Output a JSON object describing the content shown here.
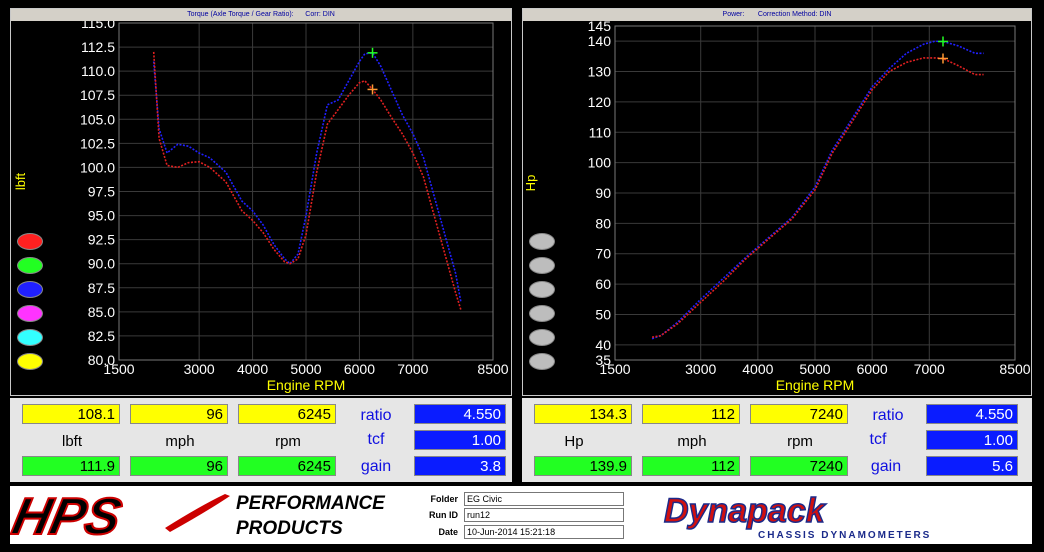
{
  "chart_data": [
    {
      "type": "line",
      "title": "Torque (Axle Torque / Gear Ratio):      Corr: DIN",
      "xlabel": "Engine RPM",
      "ylabel": "lbft",
      "xlim": [
        1500,
        8500
      ],
      "ylim": [
        80.0,
        115.0
      ],
      "xticks": [
        "1500",
        "3000",
        "4000",
        "5000",
        "6000",
        "7000",
        "8500"
      ],
      "yticks": [
        "80.0",
        "82.5",
        "85.0",
        "87.5",
        "90.0",
        "92.5",
        "95.0",
        "97.5",
        "100.0",
        "102.5",
        "105.0",
        "107.5",
        "110.0",
        "112.5",
        "115.0"
      ],
      "series": [
        {
          "color": "#2020ff",
          "x": [
            2150,
            2250,
            2400,
            2600,
            2800,
            3000,
            3200,
            3500,
            3800,
            4000,
            4200,
            4400,
            4600,
            4700,
            4850,
            5000,
            5200,
            5400,
            5600,
            5800,
            6000,
            6100,
            6245,
            6400,
            6600,
            6800,
            7000,
            7200,
            7400,
            7600,
            7800,
            7900
          ],
          "y": [
            111,
            104,
            101.5,
            102.4,
            102.2,
            101.5,
            101.0,
            99.5,
            96.5,
            95.5,
            94.0,
            92.0,
            90.5,
            90.0,
            91.0,
            95.0,
            101.5,
            106.5,
            107.0,
            109.0,
            111.0,
            111.8,
            111.9,
            110.5,
            108.0,
            105.5,
            103.5,
            101.0,
            97.0,
            93.0,
            89.0,
            86.0
          ]
        },
        {
          "color": "#e02020",
          "x": [
            2150,
            2250,
            2400,
            2600,
            2800,
            3000,
            3200,
            3500,
            3800,
            4000,
            4200,
            4400,
            4600,
            4700,
            4850,
            5000,
            5200,
            5400,
            5600,
            5800,
            6000,
            6100,
            6245,
            6400,
            6600,
            6800,
            7000,
            7200,
            7400,
            7600,
            7800,
            7900
          ],
          "y": [
            112,
            103,
            100.2,
            100.0,
            100.5,
            100.6,
            100.0,
            98.5,
            95.5,
            94.5,
            93.2,
            91.5,
            90.2,
            90.0,
            90.5,
            93.0,
            99.5,
            104.5,
            106.0,
            107.5,
            108.8,
            109.0,
            108.1,
            107.0,
            105.2,
            103.5,
            101.5,
            99.0,
            95.0,
            91.0,
            87.0,
            85.2
          ]
        }
      ],
      "markers": [
        {
          "x": 6245,
          "y": 111.9,
          "color": "#22ff22"
        },
        {
          "x": 6245,
          "y": 108.1,
          "color": "#ff9933"
        }
      ]
    },
    {
      "type": "line",
      "title": "Power:       Correction Method: DIN",
      "xlabel": "Engine RPM",
      "ylabel": "Hp",
      "xlim": [
        1500,
        8500
      ],
      "ylim": [
        35,
        145
      ],
      "xticks": [
        "1500",
        "3000",
        "4000",
        "5000",
        "6000",
        "7000",
        "8500"
      ],
      "yticks": [
        "35",
        "40",
        "50",
        "60",
        "70",
        "80",
        "90",
        "100",
        "110",
        "120",
        "130",
        "140",
        "145"
      ],
      "series": [
        {
          "color": "#2020ff",
          "x": [
            2150,
            2300,
            2600,
            3000,
            3400,
            3800,
            4200,
            4600,
            5000,
            5300,
            5600,
            6000,
            6300,
            6600,
            6900,
            7100,
            7240,
            7500,
            7800,
            7950
          ],
          "y": [
            42,
            43,
            47.5,
            55,
            62,
            69,
            75.5,
            82,
            92,
            104,
            113,
            125,
            131,
            136,
            139,
            140,
            139.9,
            138.5,
            136,
            136
          ]
        },
        {
          "color": "#e02020",
          "x": [
            2150,
            2300,
            2600,
            3000,
            3400,
            3800,
            4200,
            4600,
            5000,
            5300,
            5600,
            6000,
            6300,
            6600,
            6900,
            7100,
            7240,
            7500,
            7800,
            7950
          ],
          "y": [
            42.5,
            43,
            47,
            54,
            61,
            68.5,
            75,
            81.5,
            91,
            103,
            112,
            124,
            130,
            133,
            134.5,
            134.5,
            134.3,
            132,
            129,
            129
          ]
        }
      ],
      "markers": [
        {
          "x": 7240,
          "y": 139.9,
          "color": "#22ff22"
        },
        {
          "x": 7240,
          "y": 134.3,
          "color": "#ff9933"
        }
      ]
    }
  ],
  "torque_readout": {
    "top": [
      "108.1",
      "96",
      "6245"
    ],
    "units": [
      "lbft",
      "mph",
      "rpm"
    ],
    "bottom": [
      "111.9",
      "96",
      "6245"
    ],
    "ratio_label": "ratio",
    "ratio": "4.550",
    "tcf_label": "tcf",
    "tcf": "1.00",
    "gain_label": "gain",
    "gain": "3.8"
  },
  "power_readout": {
    "top": [
      "134.3",
      "112",
      "7240"
    ],
    "units": [
      "Hp",
      "mph",
      "rpm"
    ],
    "bottom": [
      "139.9",
      "112",
      "7240"
    ],
    "ratio_label": "ratio",
    "ratio": "4.550",
    "tcf_label": "tcf",
    "tcf": "1.00",
    "gain_label": "gain",
    "gain": "5.6"
  },
  "legend_swatches": [
    "#ff2020",
    "#22ff22",
    "#2020ff",
    "#ff33ff",
    "#33ffff",
    "#ffff00"
  ],
  "footer": {
    "logo_left": "HPS",
    "tagline_1": "PERFORMANCE",
    "tagline_2": "PRODUCTS",
    "folder_label": "Folder",
    "folder": "EG Civic",
    "runid_label": "Run ID",
    "runid": "run12",
    "date_label": "Date",
    "date": "10-Jun-2014   15:21:18",
    "logo_right": "Dynapack",
    "logo_right_sub": "CHASSIS   DYNAMOMETERS"
  }
}
